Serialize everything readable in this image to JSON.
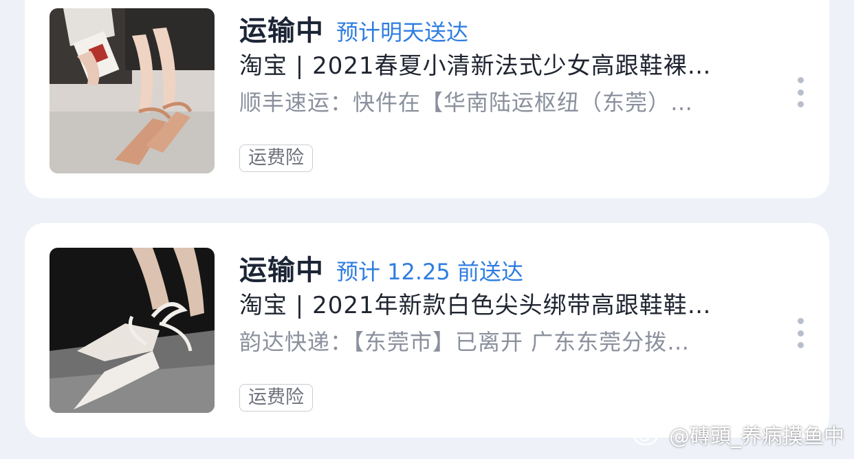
{
  "orders": [
    {
      "status": "运输中",
      "eta": "预计明天送达",
      "title": "淘宝 | 2021春夏小清新法式少女高跟鞋裸…",
      "tracking": "顺丰速运：快件在【华南陆运枢纽（东莞）…",
      "tag": "运费险"
    },
    {
      "status": "运输中",
      "eta": "预计 12.25 前送达",
      "title": "淘宝 | 2021年新款白色尖头绑带高跟鞋鞋…",
      "tracking": "韵达快递：【东莞市】已离开 广东东莞分拨…",
      "tag": "运费险"
    }
  ],
  "watermark": "@磚頭_养病摸鱼中",
  "icons": {
    "more": "more-vertical-icon",
    "weibo": "weibo-logo-icon"
  },
  "colors": {
    "eta_blue": "#2f7de1",
    "background": "#eef1f8"
  }
}
